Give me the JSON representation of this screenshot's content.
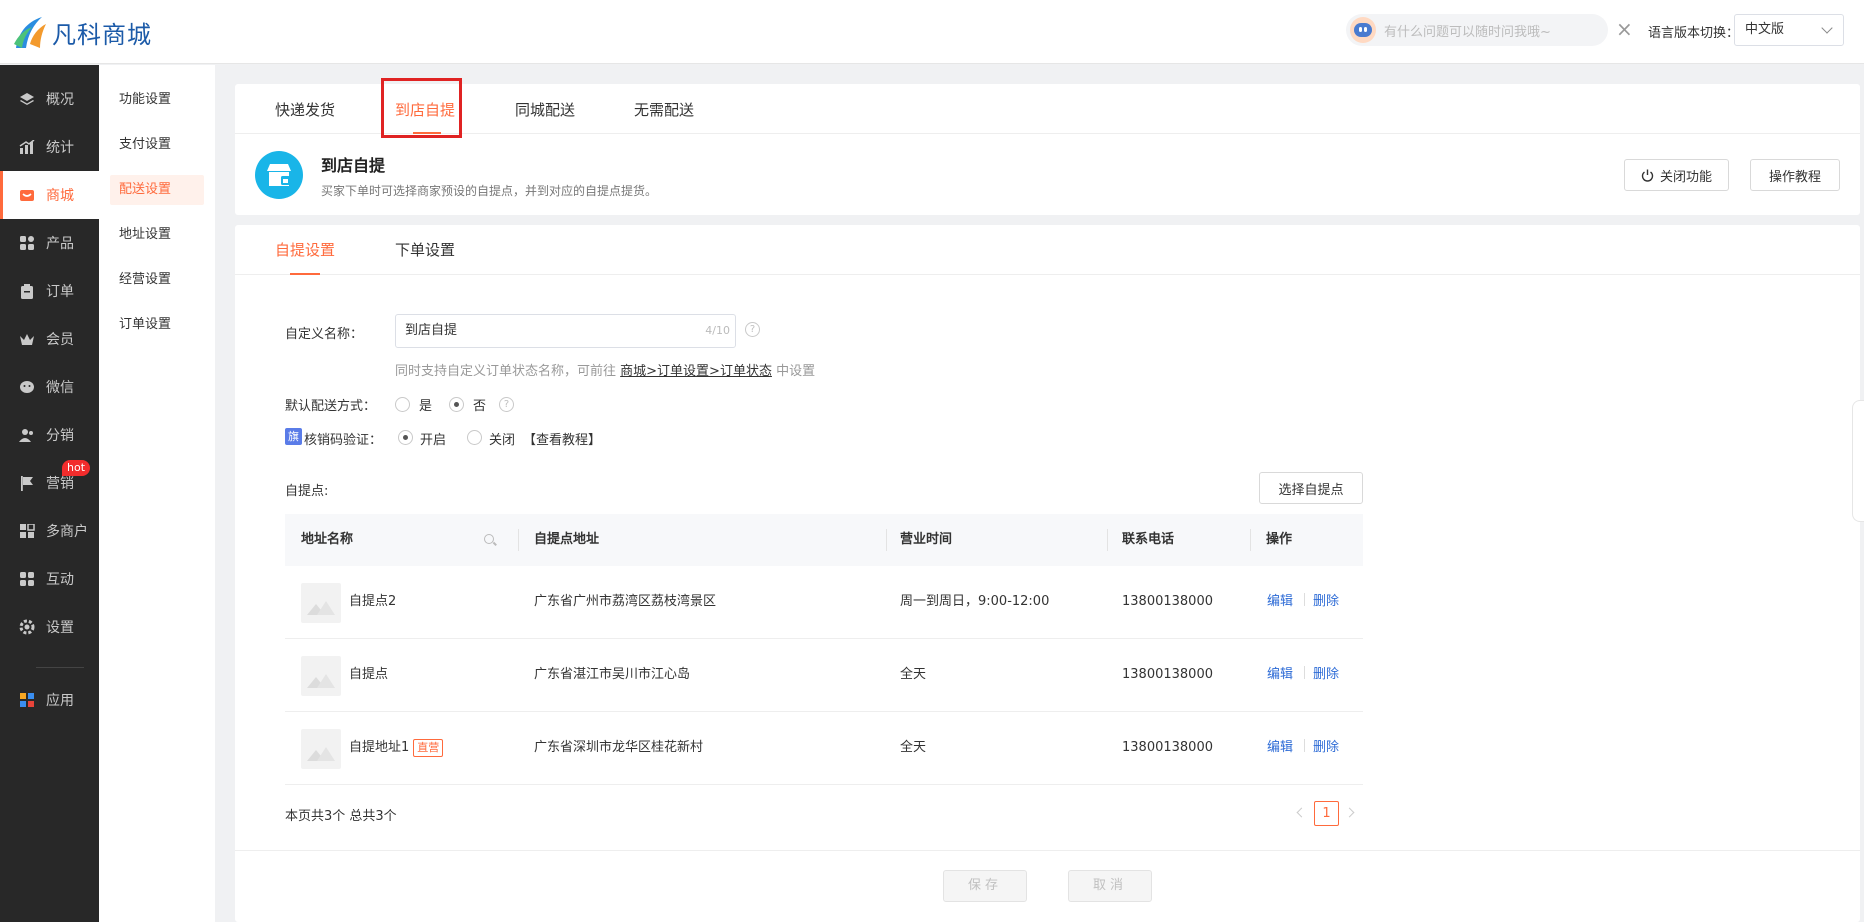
{
  "app": {
    "logo_text": "凡科商城",
    "accent": "#ff6a3c"
  },
  "header": {
    "assistant_placeholder": "有什么问题可以随时问我哦~",
    "assistant_close": "×",
    "lang_label": "语言版本切换：",
    "lang_value": "中文版"
  },
  "sidebar": {
    "items": [
      {
        "label": "概况",
        "icon": "layers-icon"
      },
      {
        "label": "统计",
        "icon": "chart-icon"
      },
      {
        "label": "商城",
        "icon": "store-icon"
      },
      {
        "label": "产品",
        "icon": "grid-icon"
      },
      {
        "label": "订单",
        "icon": "clipboard-icon"
      },
      {
        "label": "会员",
        "icon": "crown-icon"
      },
      {
        "label": "微信",
        "icon": "wechat-icon"
      },
      {
        "label": "分销",
        "icon": "users-icon"
      },
      {
        "label": "营销",
        "icon": "flag-icon"
      },
      {
        "label": "多商户",
        "icon": "shop-icon"
      },
      {
        "label": "互动",
        "icon": "grid-icon"
      },
      {
        "label": "设置",
        "icon": "gear-icon"
      },
      {
        "label": "应用",
        "icon": "apps-icon"
      }
    ],
    "hot_badge": "hot"
  },
  "submenu": {
    "items": [
      "功能设置",
      "支付设置",
      "配送设置",
      "地址设置",
      "经营设置",
      "订单设置"
    ]
  },
  "delivery_tabs": [
    "快递发货",
    "到店自提",
    "同城配送",
    "无需配送"
  ],
  "feature": {
    "title": "到店自提",
    "description": "买家下单时可选择商家预设的自提点，并到对应的自提点提货。",
    "close_button": "关闭功能",
    "tutorial_button": "操作教程"
  },
  "settings_tabs": [
    "自提设置",
    "下单设置"
  ],
  "form": {
    "name_label": "自定义名称：",
    "name_value": "到店自提",
    "name_count": "4/10",
    "hint_prefix": "同时支持自定义订单状态名称，可前往",
    "hint_link": "商城>订单设置>订单状态",
    "hint_suffix": "中设置",
    "default_label": "默认配送方式：",
    "default_yes": "是",
    "default_no": "否",
    "flag_text": "旗",
    "verify_label": "核销码验证：",
    "verify_on": "开启",
    "verify_off": "关闭",
    "verify_tutorial": "【查看教程】",
    "pickup_label": "自提点:",
    "select_button": "选择自提点",
    "help": "?"
  },
  "table": {
    "headers": [
      "地址名称",
      "自提点地址",
      "营业时间",
      "联系电话",
      "操作"
    ],
    "rows": [
      {
        "name": "自提点2",
        "tag": "",
        "address": "广东省广州市荔湾区荔枝湾景区",
        "hours": "周一到周日，9:00-12:00",
        "phone": "13800138000",
        "edit": "编辑",
        "delete": "删除"
      },
      {
        "name": "自提点",
        "tag": "",
        "address": "广东省湛江市吴川市江心岛",
        "hours": "全天",
        "phone": "13800138000",
        "edit": "编辑",
        "delete": "删除"
      },
      {
        "name": "自提地址1",
        "tag": "直营",
        "address": "广东省深圳市龙华区桂花新村",
        "hours": "全天",
        "phone": "13800138000",
        "edit": "编辑",
        "delete": "删除"
      }
    ]
  },
  "pagination": {
    "info": "本页共3个 总共3个",
    "current": "1"
  },
  "footer": {
    "save": "保存",
    "cancel": "取消"
  }
}
